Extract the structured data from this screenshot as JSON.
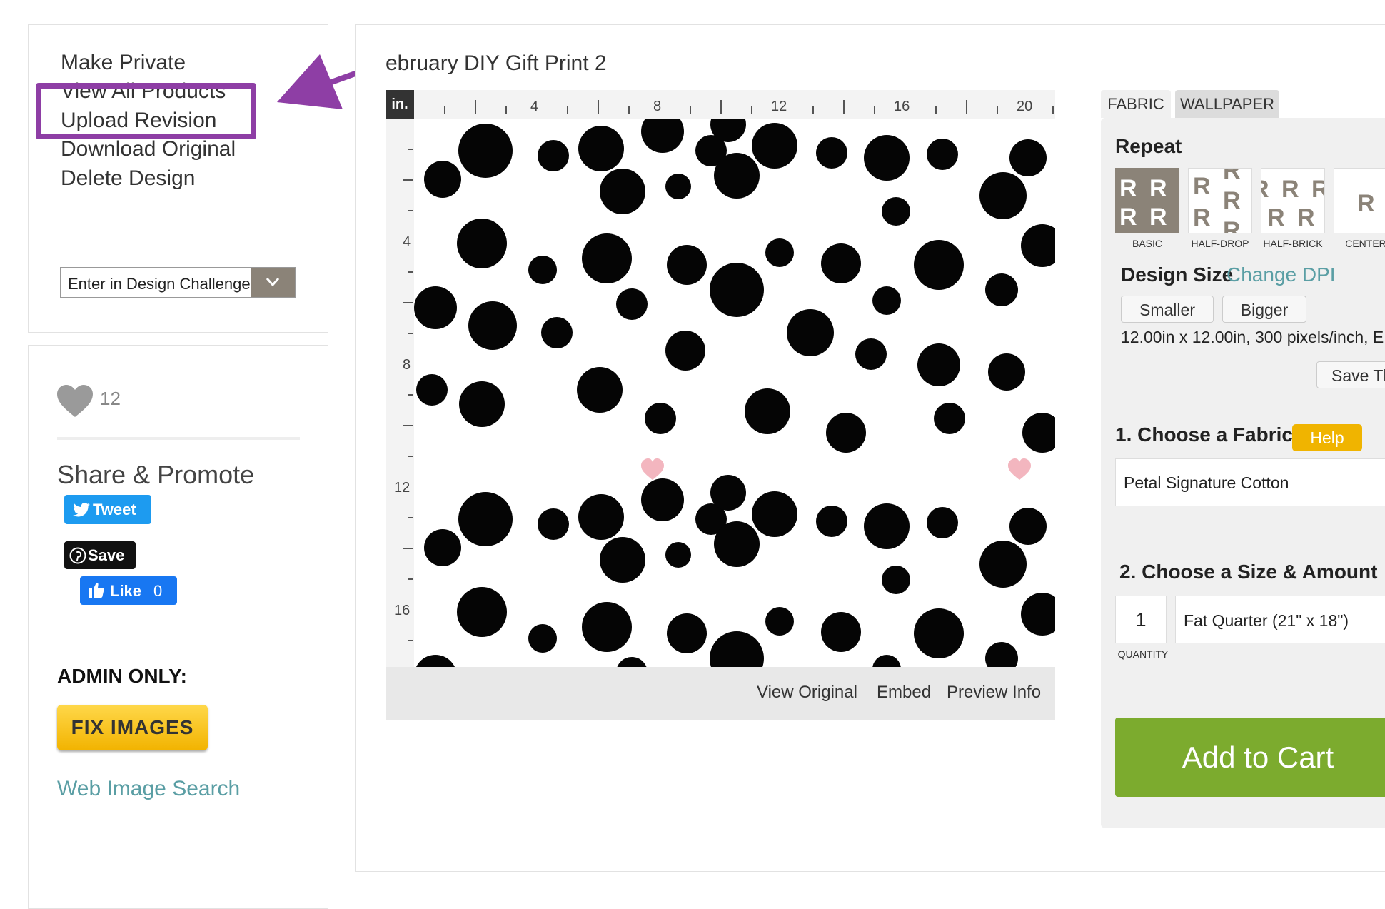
{
  "sidebar": {
    "menu": [
      "Make Private",
      "View All Products",
      "Upload Revision",
      "Download Original",
      "Delete Design"
    ],
    "challenge_select": "Enter in Design Challenge"
  },
  "social": {
    "like_count": "12",
    "share_title": "Share & Promote",
    "tweet_label": "Tweet",
    "pin_label": "Save",
    "fb_label": "Like",
    "fb_count": "0"
  },
  "admin": {
    "label": "ADMIN ONLY:",
    "fix_images": "FIX IMAGES",
    "web_image_search": "Web Image Search"
  },
  "design": {
    "title": "ebruary DIY Gift Print 2",
    "ruler_unit": "in.",
    "ruler_top_labels": [
      "4",
      "8",
      "12",
      "16",
      "20"
    ],
    "ruler_left_labels": [
      "4",
      "8",
      "12",
      "16"
    ],
    "preview_links": [
      "View Original",
      "Embed",
      "Preview Info"
    ]
  },
  "product": {
    "tabs": [
      "FABRIC",
      "WALLPAPER"
    ],
    "repeat_label": "Repeat",
    "repeat_options": [
      "BASIC",
      "HALF-DROP",
      "HALF-BRICK",
      "CENTER"
    ],
    "design_size_label": "Design Size",
    "change_dpi": "Change DPI",
    "smaller": "Smaller",
    "bigger": "Bigger",
    "size_info": "12.00in x 12.00in, 300 pixels/inch, E",
    "save_button": "Save Th",
    "choose_fabric": "1. Choose a Fabric",
    "help": "Help",
    "fabric_value": "Petal Signature Cotton",
    "choose_size": "2. Choose a Size & Amount",
    "quantity": "1",
    "quantity_label": "QUANTITY",
    "size_value": "Fat Quarter (21\" x 18\")",
    "add_to_cart": "Add to Cart"
  },
  "colors": {
    "accent_purple": "#8e3ea5",
    "link_teal": "#5a9ea4",
    "cart_green": "#7cab2e",
    "help_yellow": "#f0b400"
  }
}
